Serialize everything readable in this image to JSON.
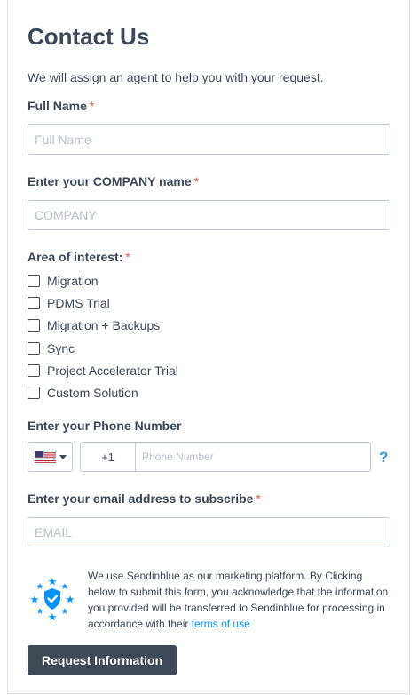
{
  "form": {
    "title": "Contact Us",
    "subtitle": "We will assign an agent to help you with your request.",
    "required_mark": "*",
    "full_name": {
      "label": "Full Name",
      "placeholder": "Full Name",
      "value": ""
    },
    "company": {
      "label": "Enter your COMPANY name",
      "placeholder": "COMPANY",
      "value": ""
    },
    "interest": {
      "label": "Area of interest:",
      "options": [
        {
          "label": "Migration",
          "checked": false
        },
        {
          "label": "PDMS Trial",
          "checked": false
        },
        {
          "label": "Migration + Backups",
          "checked": false
        },
        {
          "label": "Sync",
          "checked": false
        },
        {
          "label": "Project Accelerator Trial",
          "checked": false
        },
        {
          "label": "Custom Solution",
          "checked": false
        }
      ]
    },
    "phone": {
      "label": "Enter your Phone Number",
      "country_flag": "us-flag-icon",
      "dial_code": "+1",
      "placeholder": "Phone Number",
      "help": "?"
    },
    "email": {
      "label": "Enter your email address to subscribe",
      "placeholder": "EMAIL",
      "value": ""
    },
    "legal": {
      "text": "We use Sendinblue as our marketing platform. By Clicking below to submit this form, you acknowledge that the information you provided will be transferred to Sendinblue for processing in accordance with their ",
      "link": "terms of use"
    },
    "submit_label": "Request Information"
  },
  "colors": {
    "text": "#3c4858",
    "required": "#ff4949",
    "link": "#0092ff",
    "help": "#3b96d5",
    "button_bg": "#3e4857",
    "badge_blue": "#0092ff"
  }
}
